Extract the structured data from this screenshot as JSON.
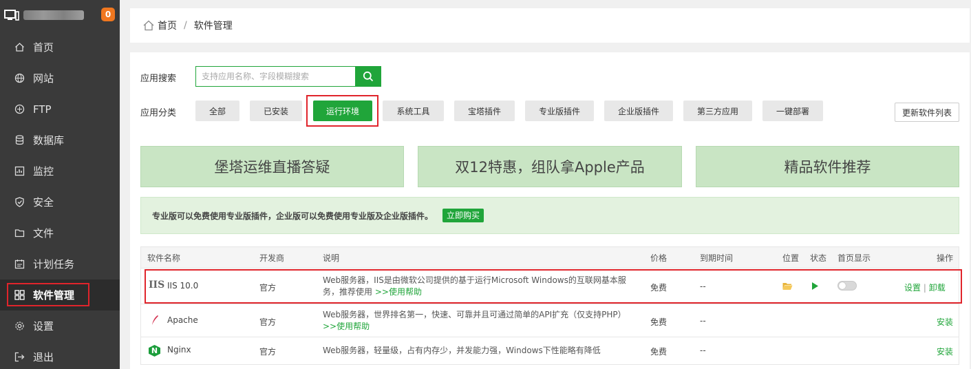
{
  "sidebar": {
    "badge": "0",
    "items": [
      {
        "label": "首页",
        "icon": "home-icon"
      },
      {
        "label": "网站",
        "icon": "globe-icon"
      },
      {
        "label": "FTP",
        "icon": "ftp-icon"
      },
      {
        "label": "数据库",
        "icon": "database-icon"
      },
      {
        "label": "监控",
        "icon": "monitor-chart-icon"
      },
      {
        "label": "安全",
        "icon": "shield-icon"
      },
      {
        "label": "文件",
        "icon": "folder-icon"
      },
      {
        "label": "计划任务",
        "icon": "calendar-icon"
      },
      {
        "label": "软件管理",
        "icon": "grid-apps-icon"
      },
      {
        "label": "设置",
        "icon": "gear-icon"
      },
      {
        "label": "退出",
        "icon": "logout-icon"
      }
    ]
  },
  "breadcrumb": {
    "home": "首页",
    "sep": "/",
    "current": "软件管理"
  },
  "search": {
    "label": "应用搜索",
    "placeholder": "支持应用名称、字段模糊搜索"
  },
  "category": {
    "label": "应用分类",
    "items": [
      "全部",
      "已安装",
      "运行环境",
      "系统工具",
      "宝塔插件",
      "专业版插件",
      "企业版插件",
      "第三方应用",
      "一键部署"
    ],
    "refresh": "更新软件列表"
  },
  "banners": [
    "堡塔运维直播答疑",
    "双12特惠，组队拿Apple产品",
    "精品软件推荐"
  ],
  "notice": {
    "text": "专业版可以免费使用专业版插件，企业版可以免费使用专业版及企业版插件。",
    "buy": "立即购买"
  },
  "table": {
    "headers": {
      "name": "软件名称",
      "dev": "开发商",
      "desc": "说明",
      "price": "价格",
      "expire": "到期时间",
      "loc": "位置",
      "status": "状态",
      "home": "首页显示",
      "ops": "操作"
    },
    "rows": [
      {
        "icon": "IIS",
        "name": "IIS 10.0",
        "dev": "官方",
        "desc1": "Web服务器，IIS是由微软公司提供的基于运行Microsoft Windows的互联网基本服",
        "desc2": "务，推荐使用",
        "help": ">>使用帮助",
        "price": "免费",
        "expire": "--",
        "op1": "设置",
        "opsep": "|",
        "op2": "卸载"
      },
      {
        "name": "Apache",
        "dev": "官方",
        "desc1": "Web服务器，世界排名第一，快速、可靠并且可通过简单的API扩充（仅支持PHP）",
        "help": ">>使用帮助",
        "price": "免费",
        "expire": "--",
        "op": "安装"
      },
      {
        "icon": "N",
        "name": "Nginx",
        "dev": "官方",
        "desc1": "Web服务器，轻量级，占有内存少，并发能力强，Windows下性能略有降低",
        "price": "免费",
        "expire": "--",
        "op": "安装"
      }
    ]
  },
  "colors": {
    "accent": "#20a53a",
    "highlight": "#e0242b",
    "badge": "#f0771f"
  }
}
